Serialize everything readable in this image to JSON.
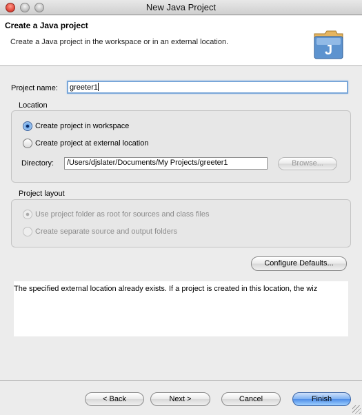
{
  "window": {
    "title": "New Java Project"
  },
  "header": {
    "title": "Create a Java project",
    "description": "Create a Java project in the workspace or in an external location.",
    "icon": "java-project-icon",
    "icon_letter": "J"
  },
  "project_name": {
    "label": "Project name:",
    "value": "greeter1"
  },
  "location": {
    "group_title": "Location",
    "option_workspace": "Create project in workspace",
    "option_external": "Create project at external location",
    "selected": "workspace",
    "directory_label": "Directory:",
    "directory_value": "/Users/djslater/Documents/My Projects/greeter1",
    "browse_label": "Browse..."
  },
  "layout": {
    "group_title": "Project layout",
    "option_root": "Use project folder as root for sources and class files",
    "option_separate": "Create separate source and output folders",
    "selected": "root"
  },
  "configure_defaults_label": "Configure Defaults...",
  "message": "The specified external location already exists. If a project is created in this location, the wiz",
  "buttons": {
    "back": "< Back",
    "next": "Next >",
    "cancel": "Cancel",
    "finish": "Finish"
  },
  "colors": {
    "accent": "#5a8fd0",
    "focus_ring": "#7aa7d9"
  }
}
